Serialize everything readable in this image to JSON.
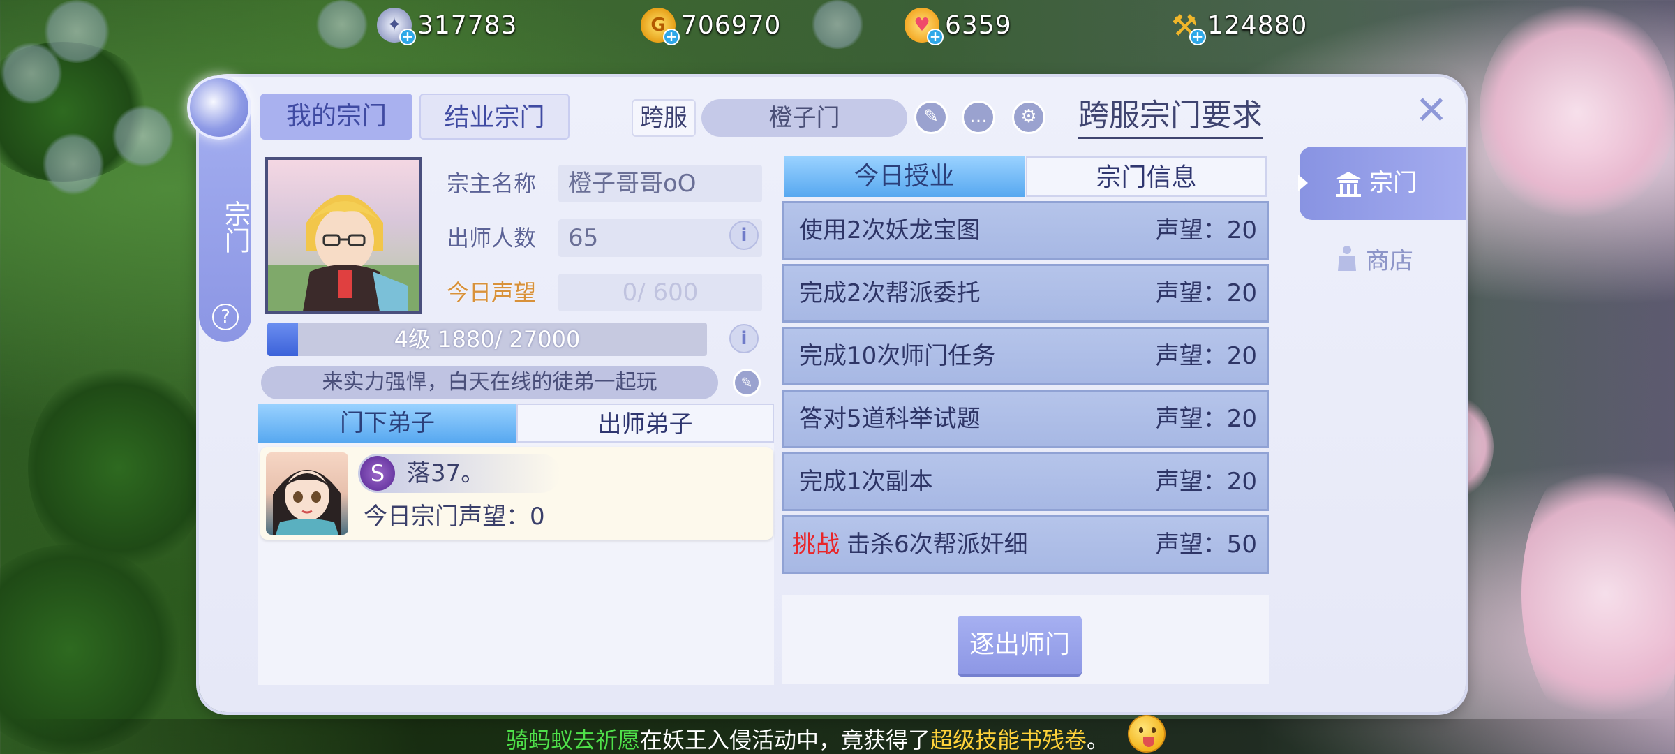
{
  "currencies": [
    {
      "icon": "silver-coin-icon",
      "value": "317783"
    },
    {
      "icon": "gold-coin-icon",
      "value": "706970"
    },
    {
      "icon": "heart-icon",
      "value": "6359"
    },
    {
      "icon": "golden-hammer-icon",
      "value": "124880"
    }
  ],
  "sidebar": {
    "title": "宗门",
    "help": "?"
  },
  "tabs": {
    "my_sect": "我的宗门",
    "graduated_sect": "结业宗门"
  },
  "header": {
    "cross_server_label": "跨服",
    "sect_name": "橙子门",
    "cross_sect_requirement": "跨服宗门要求"
  },
  "master": {
    "name_label": "宗主名称",
    "name_value": "橙子哥哥oO",
    "graduates_label": "出师人数",
    "graduates_value": "65",
    "today_rep_label": "今日声望",
    "today_rep_value": "0/ 600",
    "level_text": "4级 1880/ 27000",
    "level_progress": 0.0696,
    "motto": "来实力强悍，白天在线的徒弟一起玩"
  },
  "disciple_tabs": {
    "current": "门下弟子",
    "graduated": "出师弟子"
  },
  "disciples": [
    {
      "sect_icon": "S",
      "name": "落37。",
      "rep_label": "今日宗门声望：0"
    }
  ],
  "task_tabs": {
    "today": "今日授业",
    "info": "宗门信息"
  },
  "tasks": [
    {
      "tag": "",
      "text": "使用2次妖龙宝图",
      "reward": "声望：20"
    },
    {
      "tag": "",
      "text": "完成2次帮派委托",
      "reward": "声望：20"
    },
    {
      "tag": "",
      "text": "完成10次师门任务",
      "reward": "声望：20"
    },
    {
      "tag": "",
      "text": "答对5道科举试题",
      "reward": "声望：20"
    },
    {
      "tag": "",
      "text": "完成1次副本",
      "reward": "声望：20"
    },
    {
      "tag": "挑战",
      "text": "击杀6次帮派奸细",
      "reward": "声望：50"
    }
  ],
  "expel_button": "逐出师门",
  "right_nav": {
    "sect": "宗门",
    "shop": "商店"
  },
  "broadcast": {
    "player": "骑蚂蚁去祈愿",
    "mid": "在妖王入侵活动中，竟获得了",
    "item": "超级技能书残卷",
    "end": "。"
  },
  "colors": {
    "accent": "#a9b1ef",
    "active_tab": "#57a8f0",
    "challenge_red": "#e8262a"
  }
}
